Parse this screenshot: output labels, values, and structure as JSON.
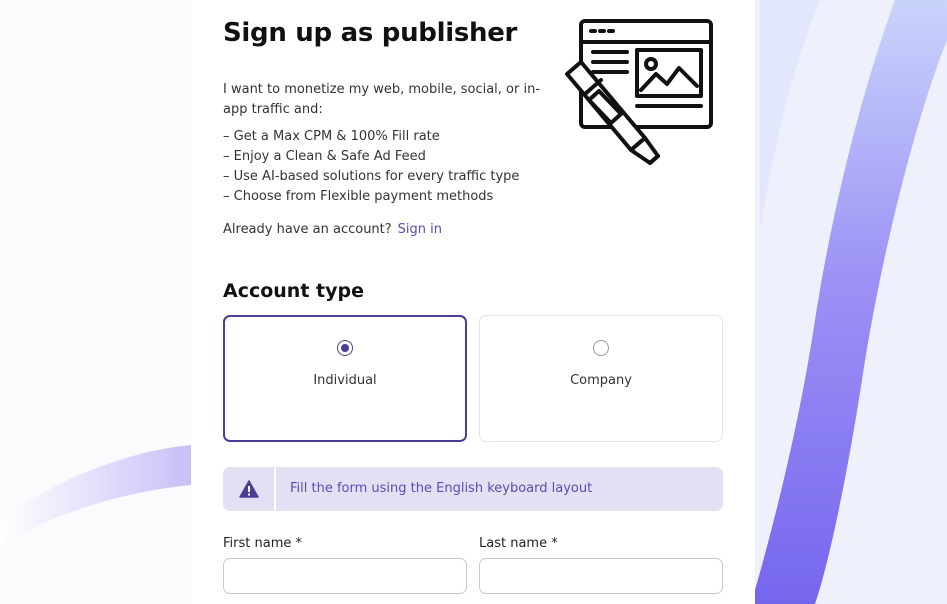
{
  "header": {
    "title": "Sign up as publisher",
    "intro": "I want to monetize my web, mobile, social, or in-app traffic and:",
    "bullets": [
      "– Get a Max CPM & 100% Fill rate",
      "– Enjoy a Clean & Safe Ad Feed",
      "– Use AI-based solutions for every traffic type",
      "– Choose from Flexible payment methods"
    ],
    "already_text": "Already have an account?",
    "signin_label": "Sign in",
    "illustration_icon": "web-design-pen-icon"
  },
  "account_type": {
    "title": "Account type",
    "options": [
      {
        "label": "Individual",
        "selected": true
      },
      {
        "label": "Company",
        "selected": false
      }
    ]
  },
  "notice": {
    "icon": "warning-icon",
    "text": "Fill the form using the English keyboard layout"
  },
  "form": {
    "first_name": {
      "label": "First name *",
      "value": ""
    },
    "last_name": {
      "label": "Last name *",
      "value": ""
    }
  },
  "colors": {
    "accent": "#4b3c96",
    "link": "#5b4bb5",
    "notice_bg": "#e3e0f4",
    "background_stripe": "#7b6cf0"
  }
}
